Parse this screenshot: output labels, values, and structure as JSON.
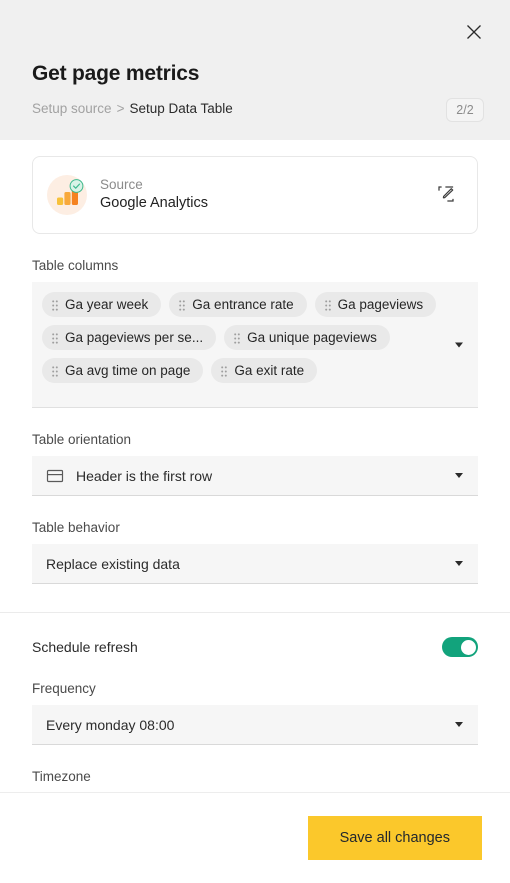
{
  "header": {
    "title": "Get page metrics",
    "breadcrumb": {
      "parent": "Setup source",
      "separator": ">",
      "current": "Setup Data Table"
    },
    "step_badge": "2/2",
    "close_icon": "close-icon"
  },
  "source_card": {
    "label": "Source",
    "value": "Google Analytics",
    "icon": "google-analytics-icon",
    "badge_icon": "check-circle-icon",
    "edit_icon": "edit-pencil-icon"
  },
  "table_columns": {
    "label": "Table columns",
    "tags": [
      "Ga year week",
      "Ga entrance rate",
      "Ga pageviews",
      "Ga pageviews per se...",
      "Ga unique pageviews",
      "Ga avg time on page",
      "Ga exit rate"
    ],
    "caret_icon": "chevron-down-icon"
  },
  "table_orientation": {
    "label": "Table orientation",
    "value": "Header is the first row",
    "icon": "table-header-icon",
    "caret_icon": "chevron-down-icon"
  },
  "table_behavior": {
    "label": "Table behavior",
    "value": "Replace existing data",
    "caret_icon": "chevron-down-icon"
  },
  "schedule_refresh": {
    "label": "Schedule refresh",
    "enabled": true
  },
  "frequency": {
    "label": "Frequency",
    "value": "Every monday 08:00",
    "caret_icon": "chevron-down-icon"
  },
  "timezone": {
    "label": "Timezone"
  },
  "footer": {
    "save_label": "Save all changes"
  },
  "colors": {
    "accent_yellow": "#fbc82b",
    "toggle_green": "#12a37c",
    "header_bg": "#f0f0f0",
    "field_bg": "#f6f6f6",
    "tag_bg": "#e9e9e9"
  }
}
